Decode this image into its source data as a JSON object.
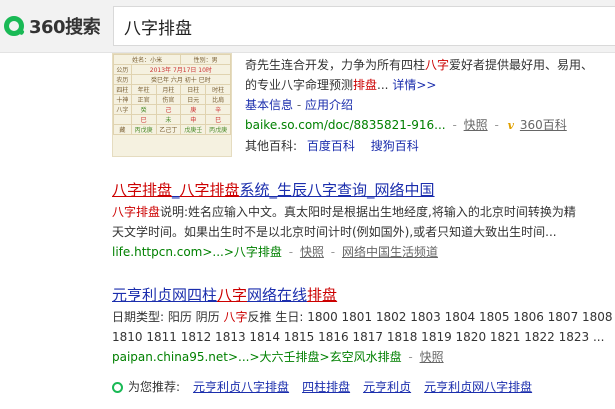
{
  "header": {
    "logo_text": "360搜索",
    "search_value": "八字排盘"
  },
  "result1": {
    "thumb": {
      "row1": [
        "姓名：小米",
        "性别：男"
      ],
      "row2": [
        "公历",
        "2013年 7月17日 10时"
      ],
      "row3": [
        "农历",
        "癸巳年 六月 初十 巳时"
      ],
      "head": [
        "四柱",
        "年柱",
        "月柱",
        "日柱",
        "时柱"
      ],
      "row_shishen": [
        "十神",
        "正官",
        "伤官",
        "日元",
        "比肩"
      ],
      "row_gan": [
        "八字",
        "癸",
        "己",
        "庚",
        "辛"
      ],
      "row_zhi": [
        "",
        "巳",
        "未",
        "申",
        "巳"
      ],
      "row_cang": [
        "藏",
        "丙戊庚",
        "乙己丁",
        "戊庚壬",
        "丙戊庚"
      ]
    },
    "desc_line1": "奇先生连合开发，力争为所有四柱",
    "desc_line1_em": "八字",
    "desc_line1_rest": "爱好者提供最好用、易用、",
    "desc_line2_pre": "的专业八字命理预测",
    "desc_line2_em": "排盘",
    "desc_line2_post": "...",
    "detail_link": "详情>>",
    "links": [
      "基本信息",
      "应用介绍"
    ],
    "links_sep": "-",
    "url": "baike.so.com/doc/8835821-916...",
    "snapshot": "快照",
    "baike_label": "360百科",
    "other_label": "其他百科:",
    "other_links": [
      "百度百科",
      "搜狗百科"
    ]
  },
  "result2": {
    "title_parts": [
      "八字排盘",
      "_",
      "八字排盘",
      "系统_生辰八字查询_网络中国"
    ],
    "line1_em": "八字排盘",
    "line1": "说明:姓名应输入中文。真太阳时是根据出生地经度,将输入的北京时间转换为精",
    "line2": "天文学时间。如果出生时不是以北京时间计时(例如国外),或者只知道大致出生时间...",
    "url": "life.httpcn.com>...>八字排盘",
    "snapshot": "快照",
    "site": "网络中国生活频道"
  },
  "result3": {
    "title_pre": "元亨利贞网四柱",
    "title_em": "八字",
    "title_post": "网络在线",
    "title_em2": "排盘",
    "line1_pre": "日期类型: 阳历 阴历 ",
    "line1_em": "八字",
    "line1_post": "反推 生日: 1800 1801 1802 1803 1804 1805 1806 1807 1808 1",
    "line2": "1810 1811 1812 1813 1814 1815 1816 1817 1818 1819 1820 1821 1822 1823 ...",
    "url": "paipan.china95.net>...>大六壬排盘>玄空风水排盘",
    "snapshot": "快照"
  },
  "recommend": {
    "label": "为您推荐:",
    "links": [
      "元亨利贞八字排盘",
      "四柱排盘",
      "元亨利贞",
      "元亨利贞网八字排盘"
    ]
  }
}
